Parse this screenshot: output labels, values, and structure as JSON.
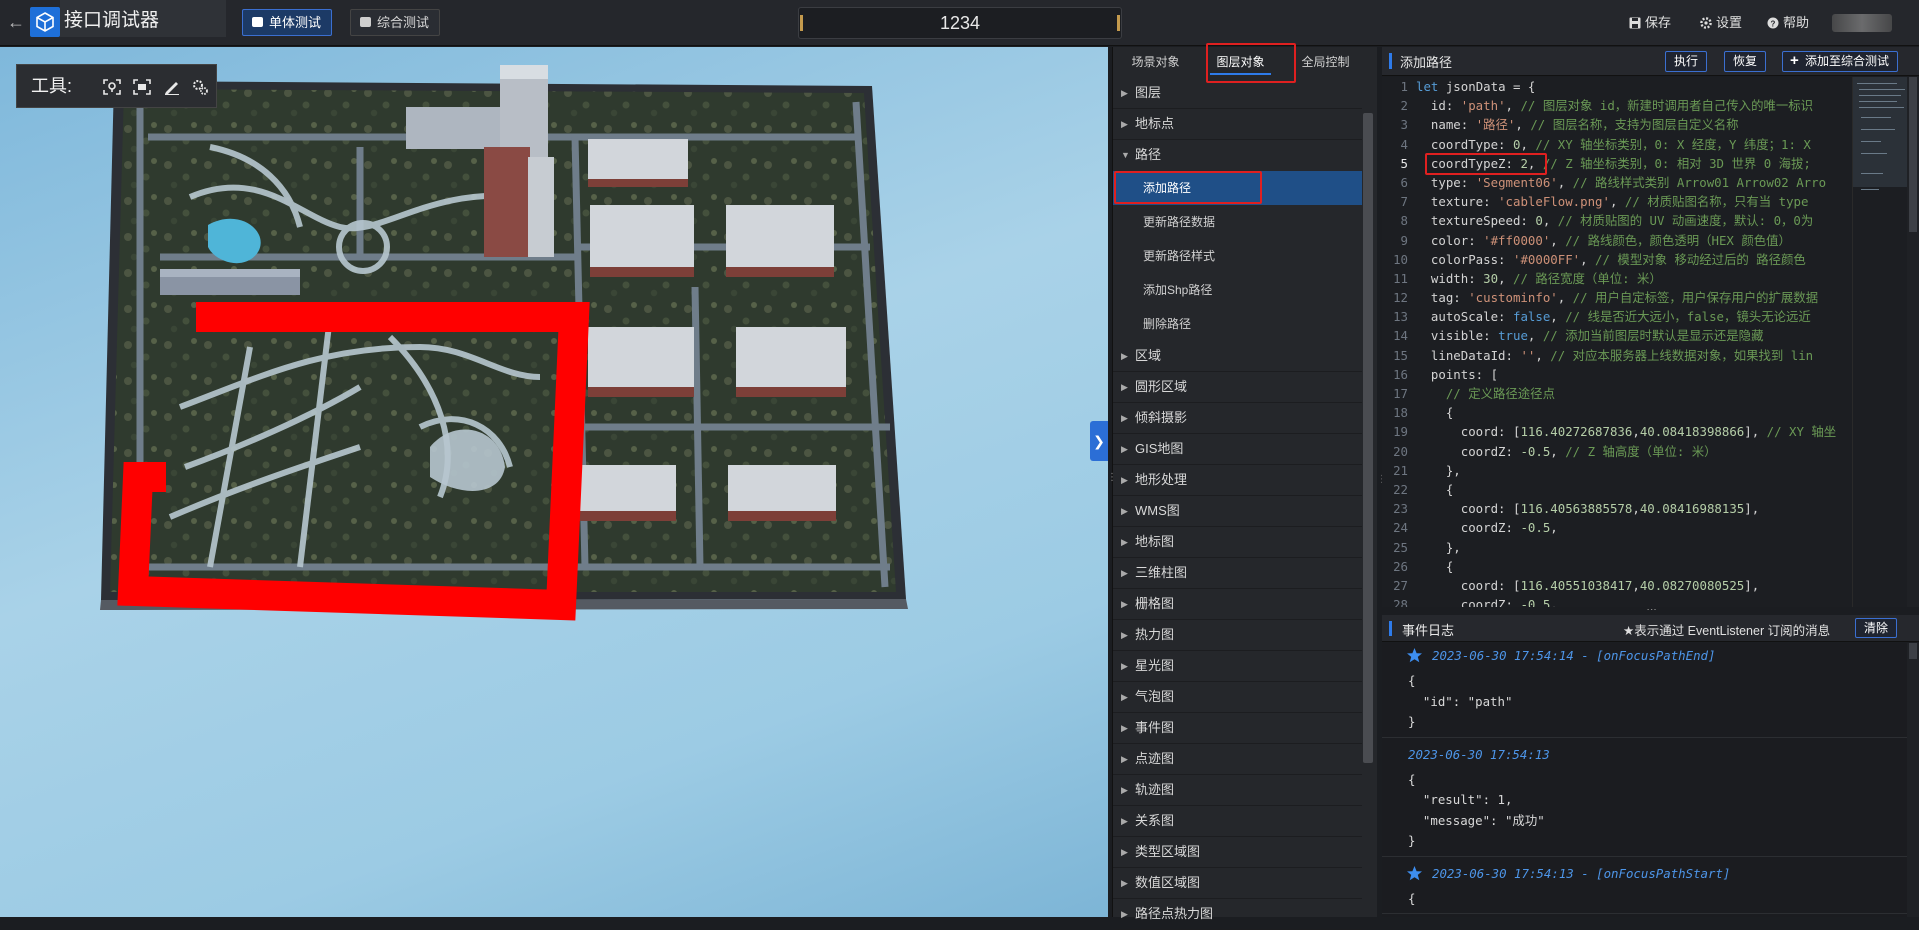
{
  "app": {
    "title": "接口调试器",
    "back_icon": "arrow-left-icon",
    "logo_icon": "cube-logo-icon"
  },
  "top_tabs": [
    {
      "label": "单体测试",
      "active": true
    },
    {
      "label": "综合测试",
      "active": false
    }
  ],
  "center_input": {
    "value": "1234"
  },
  "top_tools": {
    "save": "保存",
    "settings": "设置",
    "help": "帮助"
  },
  "viewport": {
    "toolbox_label": "工具:",
    "path_color": "#ff0000",
    "toolbox_icons": [
      "locate-icon",
      "select-area-icon",
      "pen-icon",
      "gear-cluster-icon"
    ]
  },
  "tree": {
    "tabs": [
      {
        "label": "场景对象",
        "active": false
      },
      {
        "label": "图层对象",
        "active": true
      },
      {
        "label": "全局控制",
        "active": false
      }
    ],
    "items": [
      {
        "label": "图层",
        "expanded": false
      },
      {
        "label": "地标点",
        "expanded": false
      },
      {
        "label": "路径",
        "expanded": true
      },
      {
        "label": "区域",
        "expanded": false
      },
      {
        "label": "圆形区域",
        "expanded": false
      },
      {
        "label": "倾斜摄影",
        "expanded": false
      },
      {
        "label": "GIS地图",
        "expanded": false
      },
      {
        "label": "地形处理",
        "expanded": false
      },
      {
        "label": "WMS图",
        "expanded": false
      },
      {
        "label": "地标图",
        "expanded": false
      },
      {
        "label": "三维柱图",
        "expanded": false
      },
      {
        "label": "栅格图",
        "expanded": false
      },
      {
        "label": "热力图",
        "expanded": false
      },
      {
        "label": "星光图",
        "expanded": false
      },
      {
        "label": "气泡图",
        "expanded": false
      },
      {
        "label": "事件图",
        "expanded": false
      },
      {
        "label": "点迹图",
        "expanded": false
      },
      {
        "label": "轨迹图",
        "expanded": false
      },
      {
        "label": "关系图",
        "expanded": false
      },
      {
        "label": "类型区域图",
        "expanded": false
      },
      {
        "label": "数值区域图",
        "expanded": false
      },
      {
        "label": "路径点热力图",
        "expanded": false
      }
    ],
    "path_children": [
      {
        "label": "添加路径",
        "selected": true
      },
      {
        "label": "更新路径数据",
        "selected": false
      },
      {
        "label": "更新路径样式",
        "selected": false
      },
      {
        "label": "添加Shp路径",
        "selected": false
      },
      {
        "label": "删除路径",
        "selected": false
      }
    ]
  },
  "code_panel": {
    "title": "添加路径",
    "buttons": {
      "run": "执行",
      "restore": "恢复",
      "add": "添加至综合测试"
    },
    "current_line": 5,
    "lines": [
      "let jsonData = {",
      "  id: 'path', // 图层对象 id，新建时调用者自己传入的唯一标识",
      "  name: '路径', // 图层名称，支持为图层自定义名称",
      "  coordType: 0, // XY 轴坐标类别，0: X 经度，Y 纬度；1: X",
      "  coordTypeZ: 2, // Z 轴坐标类别，0: 相对 3D 世界 0 海拔;",
      "  type: 'Segment06', // 路线样式类别 Arrow01 Arrow02 Arro",
      "  texture: 'cableFlow.png', // 材质贴图名称，只有当 type",
      "  textureSpeed: 0, // 材质贴图的 UV 动画速度，默认: 0，0为",
      "  color: '#ff0000', // 路线颜色，颜色透明（HEX 颜色值）",
      "  colorPass: '#0000FF', // 模型对象 移动经过后的 路径颜色",
      "  width: 30, // 路径宽度（单位: 米）",
      "  tag: 'custominfo', // 用户自定标签，用户保存用户的扩展数据",
      "  autoScale: false, // 线是否近大远小，false，镜头无论远近",
      "  visible: true, // 添加当前图层时默认是显示还是隐藏",
      "  lineDataId: '', // 对应本服务器上线数据对象，如果找到 lin",
      "  points: [",
      "    // 定义路径途径点",
      "    {",
      "      coord: [116.40272687836,40.08418398866], // XY 轴坐",
      "      coordZ: -0.5, // Z 轴高度（单位: 米）",
      "    },",
      "    {",
      "      coord: [116.40563885578,40.08416988135],",
      "      coordZ: -0.5,",
      "    },",
      "    {",
      "      coord: [116.40551038417,40.08270080525],",
      "      coordZ: -0.5,"
    ]
  },
  "event_log": {
    "title": "事件日志",
    "hint": "★表示通过 EventListener 订阅的消息",
    "clear": "清除",
    "entries": [
      {
        "starred": true,
        "timestamp": "2023-06-30 17:54:14 - [onFocusPathEnd]",
        "json": "{\n  \"id\": \"path\"\n}"
      },
      {
        "starred": false,
        "timestamp": "2023-06-30 17:54:13",
        "json": "{\n  \"result\": 1,\n  \"message\": \"成功\"\n}"
      },
      {
        "starred": true,
        "timestamp": "2023-06-30 17:54:13 - [onFocusPathStart]",
        "json": "{"
      }
    ]
  }
}
